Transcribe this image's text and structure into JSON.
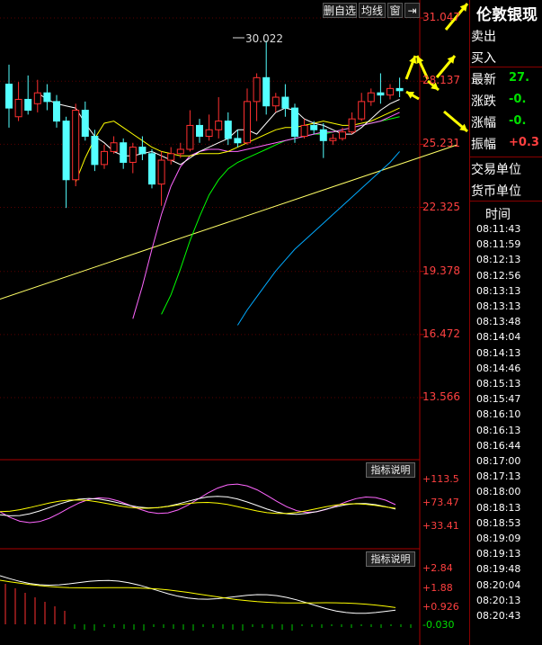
{
  "toolbar": {
    "self_select": "删自选",
    "ma": "均线",
    "window": "窗"
  },
  "annotation": "30.022",
  "price_labels": [
    "31.047",
    "28.137",
    "25.231",
    "22.325",
    "19.378",
    "16.472",
    "13.566"
  ],
  "panel1": {
    "label": "指标说明",
    "values": [
      "+113.5",
      "+73.47",
      "+33.41"
    ]
  },
  "panel2": {
    "label": "指标说明",
    "values": [
      "+2.84",
      "+1.88",
      "+0.926",
      "-0.030"
    ]
  },
  "sidebar": {
    "title": "伦敦银现",
    "quote": [
      {
        "label": "卖出",
        "value": ""
      },
      {
        "label": "买入",
        "value": ""
      },
      {
        "label": "最新",
        "value": "27.",
        "color": "#00e000"
      },
      {
        "label": "涨跌",
        "value": "-0.",
        "color": "#00e000"
      },
      {
        "label": "涨幅",
        "value": "-0.",
        "color": "#00e000"
      },
      {
        "label": "振幅",
        "value": "+0.3",
        "color": "#ff4040"
      }
    ],
    "trade_unit": "交易单位",
    "currency_unit": "货币单位",
    "time_header": "时间",
    "times": [
      "08:11:43",
      "08:11:59",
      "08:12:13",
      "08:12:56",
      "08:13:13",
      "08:13:13",
      "08:13:48",
      "08:14:04",
      "08:14:13",
      "08:14:46",
      "08:15:13",
      "08:15:47",
      "08:16:10",
      "08:16:13",
      "08:16:44",
      "08:17:00",
      "08:17:13",
      "08:18:00",
      "08:18:13",
      "08:18:53",
      "08:19:09",
      "08:19:13",
      "08:19:48",
      "08:20:04",
      "08:20:13",
      "08:20:43"
    ]
  },
  "colors": {
    "up": "#ff3030",
    "down": "#54ffff",
    "ma5": "#ffffff",
    "ma10": "#ffff00",
    "ma20": "#ff66ff",
    "ma30": "#00ff00",
    "ma60": "#00aaff",
    "trend": "#ffff66",
    "arrow": "#ffff00"
  },
  "chart_data": {
    "type": "candlestick",
    "y_range": [
      13.566,
      31.047
    ],
    "y_ticks": [
      31.047,
      28.137,
      25.231,
      22.325,
      19.378,
      16.472,
      13.566
    ],
    "candles": [
      [
        28.0,
        28.9,
        26.9,
        26.0
      ],
      [
        26.5,
        28.1,
        27.3,
        26.3
      ],
      [
        27.3,
        28.4,
        26.8,
        26.6
      ],
      [
        27.1,
        28.2,
        27.6,
        26.7
      ],
      [
        27.6,
        28.0,
        27.2,
        26.8
      ],
      [
        27.2,
        27.5,
        26.3,
        26.0
      ],
      [
        26.3,
        26.5,
        23.6,
        22.3
      ],
      [
        23.6,
        27.1,
        26.8,
        23.3
      ],
      [
        26.8,
        27.2,
        25.6,
        25.4
      ],
      [
        25.6,
        25.9,
        24.3,
        24.0
      ],
      [
        24.3,
        25.2,
        24.9,
        24.1
      ],
      [
        24.9,
        25.6,
        25.3,
        24.8
      ],
      [
        25.3,
        25.5,
        24.4,
        24.1
      ],
      [
        24.4,
        25.3,
        25.1,
        23.9
      ],
      [
        25.1,
        25.6,
        24.8,
        24.5
      ],
      [
        24.8,
        25.0,
        23.4,
        23.2
      ],
      [
        23.4,
        24.9,
        24.5,
        22.4
      ],
      [
        24.5,
        25.1,
        24.8,
        24.3
      ],
      [
        24.8,
        25.3,
        25.0,
        24.6
      ],
      [
        25.0,
        26.8,
        26.1,
        24.9
      ],
      [
        26.1,
        26.4,
        25.6,
        25.3
      ],
      [
        25.6,
        26.6,
        25.9,
        25.4
      ],
      [
        25.9,
        27.4,
        26.3,
        25.5
      ],
      [
        26.3,
        26.7,
        25.5,
        25.2
      ],
      [
        25.5,
        25.9,
        25.3,
        25.1
      ],
      [
        25.3,
        27.8,
        27.2,
        25.2
      ],
      [
        27.2,
        28.5,
        28.3,
        26.3
      ],
      [
        28.3,
        30.0,
        27.0,
        26.6
      ],
      [
        27.0,
        27.6,
        27.4,
        26.7
      ],
      [
        27.4,
        28.0,
        26.9,
        26.5
      ],
      [
        26.9,
        27.1,
        25.6,
        25.3
      ],
      [
        25.6,
        26.4,
        26.1,
        25.5
      ],
      [
        26.1,
        26.3,
        25.9,
        25.7
      ],
      [
        25.9,
        26.2,
        25.4,
        24.6
      ],
      [
        25.4,
        25.7,
        25.5,
        25.2
      ],
      [
        25.5,
        26.0,
        25.8,
        25.4
      ],
      [
        25.8,
        26.7,
        26.4,
        25.7
      ],
      [
        26.4,
        27.6,
        27.2,
        26.3
      ],
      [
        27.2,
        27.8,
        27.6,
        27.0
      ],
      [
        27.6,
        28.5,
        27.5,
        27.1
      ],
      [
        27.5,
        28.0,
        27.8,
        27.3
      ],
      [
        27.8,
        28.3,
        27.7,
        27.4
      ]
    ],
    "ma5": [
      27.6,
      27.3,
      27.1,
      27.0,
      26.9,
      26.2,
      25.6,
      25.3,
      24.9,
      24.7,
      24.7,
      24.8,
      24.9,
      24.7,
      24.5,
      24.3,
      24.6,
      24.9,
      25.1,
      25.3,
      25.5,
      25.9,
      25.9,
      25.7,
      26.2,
      26.7,
      26.9,
      26.8,
      26.4,
      26.2,
      26.1,
      25.9,
      25.7,
      25.7,
      26.0,
      26.4,
      26.8,
      27.1,
      27.3
    ],
    "ma10": [
      23.5,
      24.6,
      25.5,
      26.2,
      26.3,
      26.0,
      25.7,
      25.4,
      25.1,
      24.9,
      24.8,
      24.7,
      24.7,
      24.8,
      24.8,
      24.8,
      24.9,
      25.1,
      25.3,
      25.5,
      25.7,
      25.9,
      26.0,
      26.0,
      26.1,
      26.2,
      26.3,
      26.2,
      26.1,
      26.1,
      26.2,
      26.3,
      26.5,
      26.7,
      26.9
    ],
    "ma20": [
      17.2,
      18.7,
      20.4,
      22.0,
      23.3,
      24.2,
      24.7,
      24.9,
      25.0,
      25.0,
      24.9,
      24.9,
      25.0,
      25.1,
      25.2,
      25.3,
      25.4,
      25.5,
      25.6,
      25.7,
      25.8,
      25.8,
      25.9,
      26.0,
      26.1,
      26.2,
      26.3,
      26.5,
      26.7
    ],
    "ma30": [
      17.4,
      18.3,
      19.5,
      20.8,
      21.9,
      22.9,
      23.6,
      24.1,
      24.4,
      24.6,
      24.8,
      25.0,
      25.2,
      25.4,
      25.5,
      25.6,
      25.7,
      25.7,
      25.8,
      25.9,
      26.0,
      26.1,
      26.2,
      26.3,
      26.4,
      26.5
    ],
    "ma60": [
      16.9,
      17.6,
      18.2,
      18.8,
      19.4,
      19.9,
      20.4,
      20.8,
      21.2,
      21.6,
      22.0,
      22.4,
      22.8,
      23.2,
      23.6,
      24.0,
      24.4,
      24.9
    ],
    "trend": [
      [
        0,
        18.1
      ],
      [
        47,
        25.2
      ]
    ]
  }
}
